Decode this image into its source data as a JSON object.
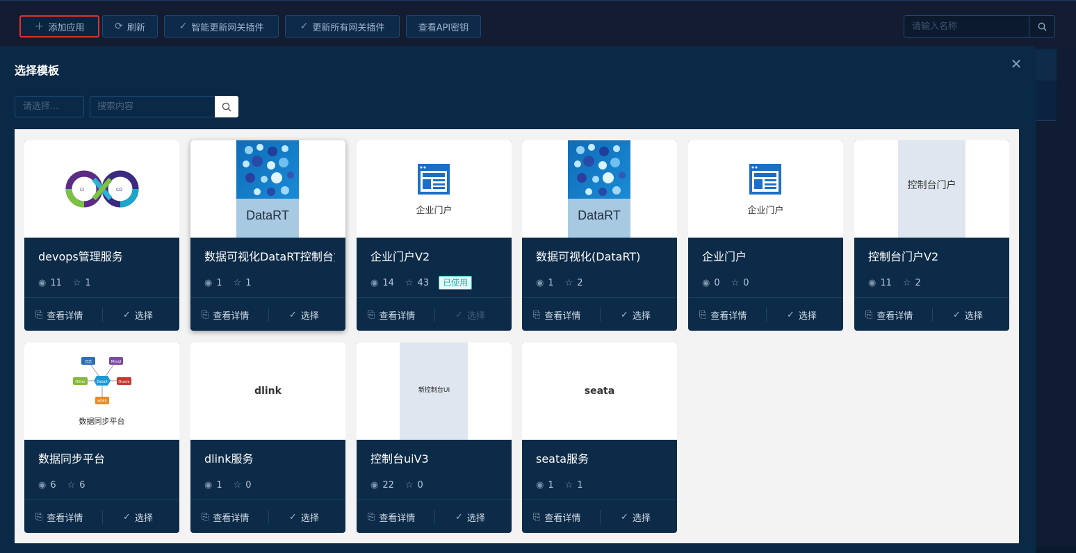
{
  "toolbar": {
    "add_app": "添加应用",
    "refresh": "刷新",
    "smart_update": "智能更新网关插件",
    "update_all": "更新所有网关插件",
    "view_api_key": "查看API密钥",
    "search_placeholder": "请输入名称"
  },
  "modal": {
    "title": "选择模板",
    "select_placeholder": "请选择...",
    "search_placeholder": "搜索内容"
  },
  "card_actions": {
    "details": "查看详情",
    "select": "选择"
  },
  "cards": [
    {
      "name": "devops管理服务",
      "views": "11",
      "stars": "1",
      "image": "cicd-infinity-logo"
    },
    {
      "name": "数据可视化DataRT控制台第",
      "views": "1",
      "stars": "1",
      "image": "datart-logo",
      "image_text": "DataRT"
    },
    {
      "name": "企业门户V2",
      "views": "14",
      "stars": "43",
      "image": "portal-window-icon",
      "image_text": "企业门户",
      "badge": "已使用"
    },
    {
      "name": "数据可视化(DataRT)",
      "views": "1",
      "stars": "2",
      "image": "datart-logo",
      "image_text": "DataRT"
    },
    {
      "name": "企业门户",
      "views": "0",
      "stars": "0",
      "image": "portal-window-icon",
      "image_text": "企业门户"
    },
    {
      "name": "控制台门户V2",
      "views": "11",
      "stars": "2",
      "image": "text-panel",
      "image_text": "控制台门户"
    },
    {
      "name": "数据同步平台",
      "views": "6",
      "stars": "6",
      "image": "datax-sync-diagram",
      "image_text": "数据同步平台",
      "diagram_nodes": [
        "日志",
        "Mysql",
        "Other",
        "DataX",
        "Oracle",
        "HDFS"
      ]
    },
    {
      "name": "dlink服务",
      "views": "1",
      "stars": "0",
      "image": "text-only",
      "image_text": "dlink"
    },
    {
      "name": "控制台uiV3",
      "views": "22",
      "stars": "0",
      "image": "text-panel",
      "image_text": "新控制台UI"
    },
    {
      "name": "seata服务",
      "views": "1",
      "stars": "1",
      "image": "text-only",
      "image_text": "seata"
    }
  ],
  "colors": {
    "accent_red": "#e0312f",
    "card_bg": "#0c2b48",
    "badge_teal": "#16b3b9"
  }
}
